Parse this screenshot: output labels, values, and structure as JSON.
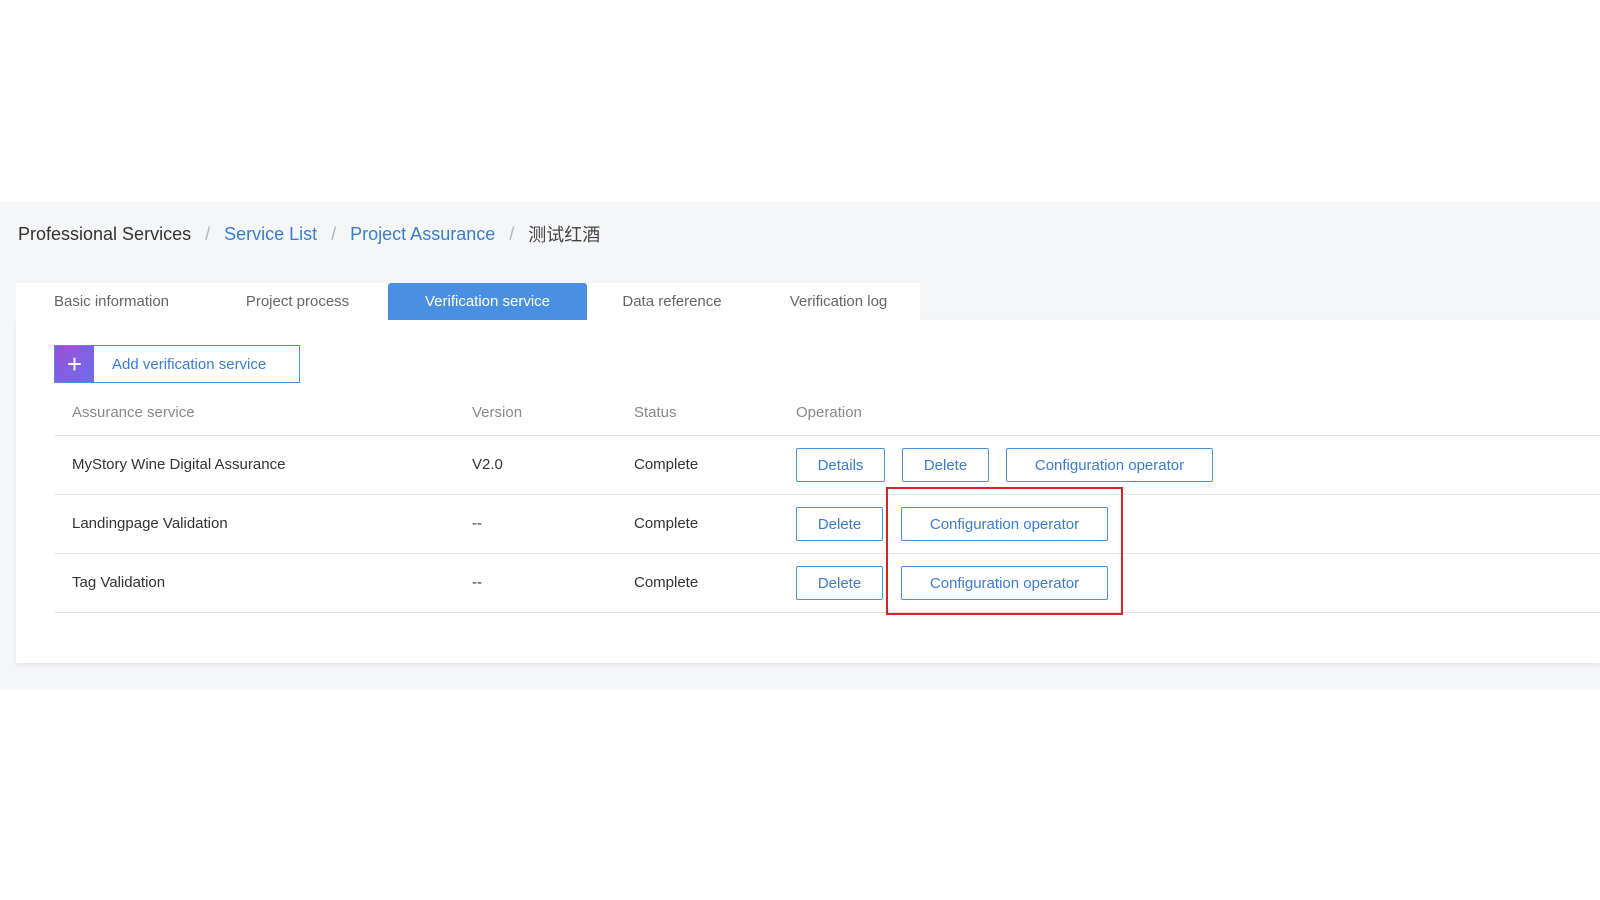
{
  "breadcrumb": {
    "root": "Professional Services",
    "separator": "/",
    "link1": "Service List",
    "link2": "Project Assurance",
    "current": "测试红酒"
  },
  "tabs": [
    {
      "label": "Basic information"
    },
    {
      "label": "Project process"
    },
    {
      "label": "Verification service"
    },
    {
      "label": "Data reference"
    },
    {
      "label": "Verification log"
    }
  ],
  "active_tab": "Verification service",
  "add_button": {
    "icon": "plus-icon",
    "label": "Add verification service"
  },
  "table": {
    "headers": [
      "Assurance service",
      "Version",
      "Status",
      "Operation"
    ],
    "rows": [
      {
        "service": "MyStory Wine Digital Assurance",
        "version": "V2.0",
        "status": "Complete",
        "operations": [
          "Details",
          "Delete",
          "Configuration operator"
        ]
      },
      {
        "service": "Landingpage Validation",
        "version": "--",
        "status": "Complete",
        "operations": [
          "Delete",
          "Configuration operator"
        ]
      },
      {
        "service": "Tag Validation",
        "version": "--",
        "status": "Complete",
        "operations": [
          "Delete",
          "Configuration operator"
        ]
      }
    ]
  },
  "colors": {
    "accent": "#4a90e2",
    "link": "#3a7bd5",
    "highlight": "#e02020",
    "add_icon_gradient": [
      "#9b4fd6",
      "#6a6ff0"
    ]
  }
}
